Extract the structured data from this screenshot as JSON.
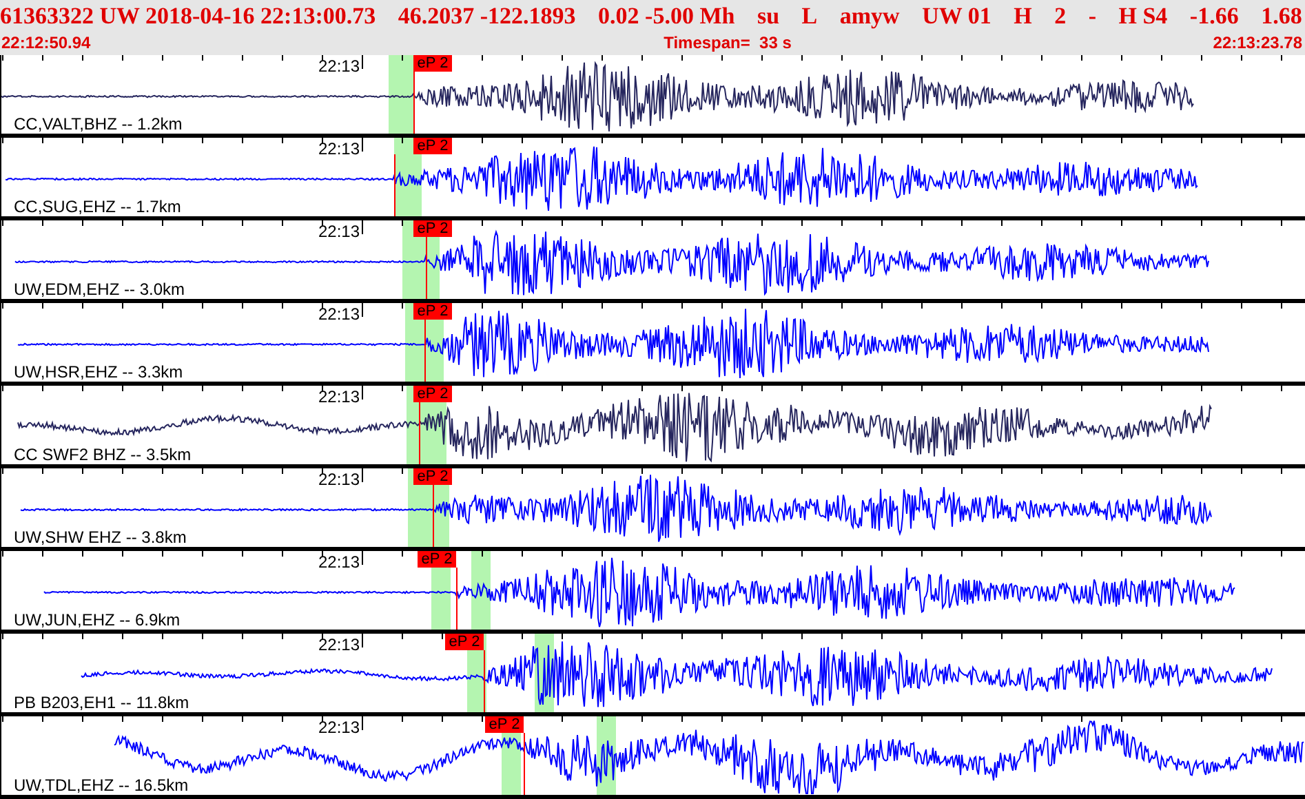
{
  "header": {
    "event_line": [
      "61363322 UW 2018-04-16 22:13:00.73",
      "46.2037 -122.1893",
      "0.02 -5.00 Mh",
      "su",
      "L",
      "amyw",
      "UW 01",
      "H",
      "2",
      "-",
      "H S4",
      "-1.66",
      "1.68"
    ],
    "start_time": "22:12:50.94",
    "timespan": "Timespan=  33 s",
    "end_time": "22:13:23.78"
  },
  "traces": [
    {
      "station": "CC,VALT,BHZ -- 1.2km",
      "time_label": "22:13",
      "pick": "eP 2",
      "color": "#26265e"
    },
    {
      "station": "CC,SUG,EHZ -- 1.7km",
      "time_label": "22:13",
      "pick": "eP 2",
      "color": "#0000ff"
    },
    {
      "station": "UW,EDM,EHZ -- 3.0km",
      "time_label": "22:13",
      "pick": "eP 2",
      "color": "#0000ff"
    },
    {
      "station": "UW,HSR,EHZ -- 3.3km",
      "time_label": "22:13",
      "pick": "eP 2",
      "color": "#0000ff"
    },
    {
      "station": "CC SWF2 BHZ -- 3.5km",
      "time_label": "22:13",
      "pick": "eP 2",
      "color": "#26265e"
    },
    {
      "station": "UW,SHW EHZ -- 3.8km",
      "time_label": "22:13",
      "pick": "eP 2",
      "color": "#0000ff"
    },
    {
      "station": "UW,JUN,EHZ -- 6.9km",
      "time_label": "22:13",
      "pick": "eP 2",
      "color": "#0000ff"
    },
    {
      "station": "PB B203,EH1 -- 11.8km",
      "time_label": "22:13",
      "pick": "eP 2",
      "color": "#0000ff"
    },
    {
      "station": "UW,TDL,EHZ -- 16.5km",
      "time_label": "22:13",
      "pick": "eP 2",
      "color": "#0000ff"
    }
  ]
}
